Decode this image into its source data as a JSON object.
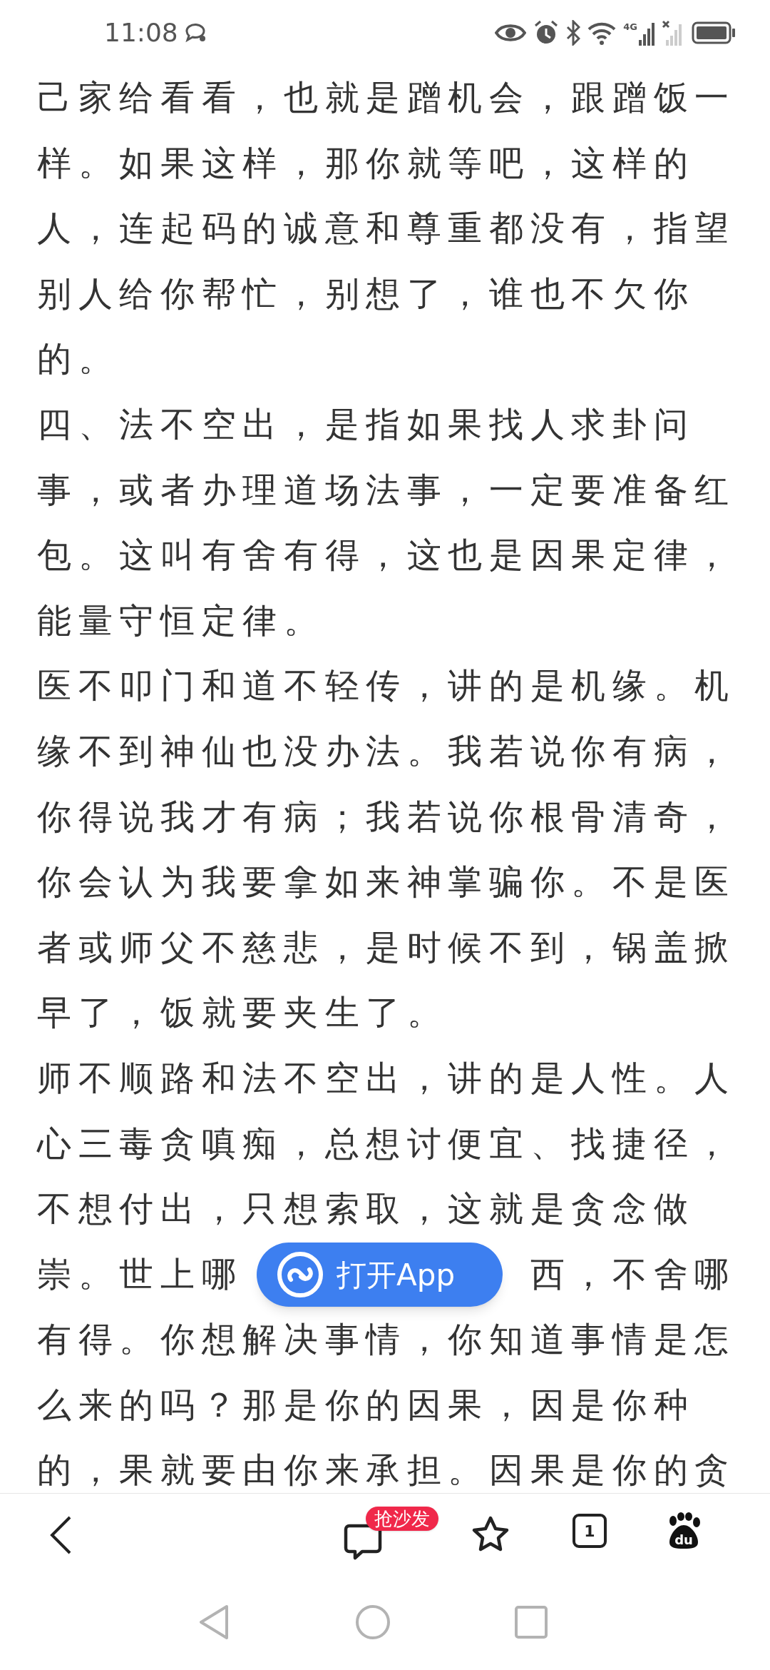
{
  "status_bar": {
    "time": "11:08",
    "network": "4G"
  },
  "article": {
    "paragraphs": [
      {
        "segments": [
          "己家给看看，也就是蹭机会，跟蹭饭一样。如果这样，那你就等吧，这样的人，连起码的诚意和尊重都没有，指望别人给你帮忙，别想了，谁也不欠你的。"
        ]
      },
      {
        "segments": [
          "四、法不空出，是指如果找人求卦问事，或者办理道场法事，一定要准备红包。这叫有舍有得，这也是因果定律，能量守恒定律。"
        ]
      },
      {
        "segments": [
          "医不叩门和道不轻传，讲的是机缘。机缘不到神仙也没办法。我若说你有病，你得说我才有病；我若说你根骨清奇，你会认为我要拿如来神掌骗你。不是医者或师父不慈悲，是时候不到，锅盖掀早了，饭就要夹生了。"
        ]
      },
      {
        "segments": [
          "师不顺路和法不空出，讲的是人性。人心三毒贪嗔痴，总想讨便宜、找捷径，不想付出，只想索取，这就是贪念做",
          "崇。世上哪",
          "西，不舍哪",
          "有得。你想解决事情，你知道事情是怎么来的吗？那是你的因果，因是你种的，果就要由你来承担。因果是你的贪"
        ]
      }
    ]
  },
  "open_app_button": {
    "label": "打开App"
  },
  "toolbar": {
    "comment_badge": "抢沙发",
    "tab_count": "1",
    "logo_text": "du"
  }
}
